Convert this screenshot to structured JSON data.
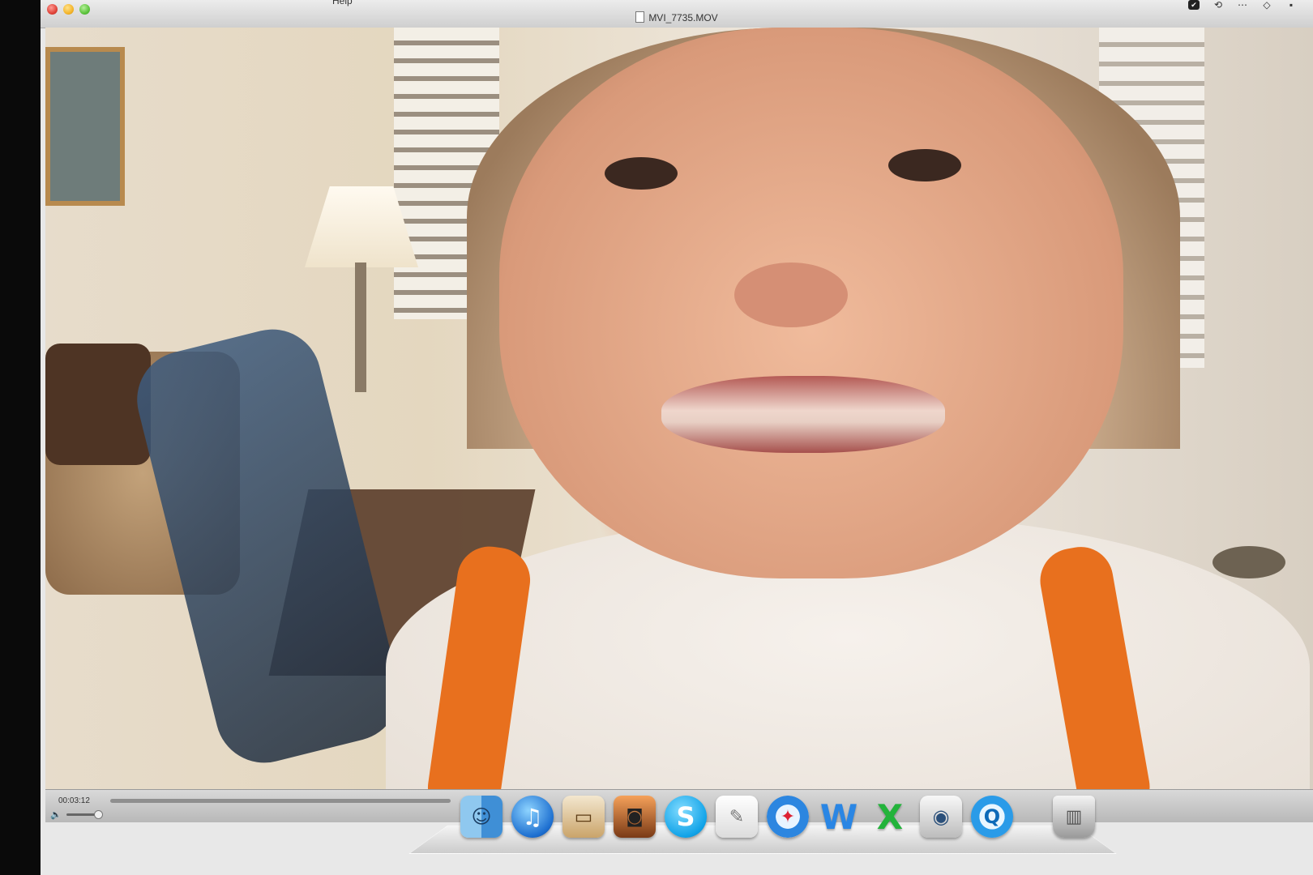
{
  "window": {
    "title": "MVI_7735.MOV",
    "menu_fragment": "Help"
  },
  "menubar_extras": [
    {
      "icon": "shield-check-icon",
      "glyph": "✔"
    },
    {
      "icon": "time-machine-icon",
      "glyph": "⟲"
    },
    {
      "icon": "sync-icon",
      "glyph": "⋯"
    },
    {
      "icon": "wifi-icon",
      "glyph": "◇"
    },
    {
      "icon": "flag-icon",
      "glyph": "▪"
    }
  ],
  "controller": {
    "timecode": "00:03:12",
    "volume_glyph": "🔈"
  },
  "dock": {
    "items": [
      {
        "name": "Finder",
        "glyph": "☺"
      },
      {
        "name": "iTunes",
        "glyph": "♫"
      },
      {
        "name": "Keynote",
        "glyph": "▭"
      },
      {
        "name": "iPhoto",
        "glyph": "◙"
      },
      {
        "name": "Skype",
        "glyph": "S"
      },
      {
        "name": "TextEdit",
        "glyph": "✎"
      },
      {
        "name": "Safari",
        "glyph": "✦"
      },
      {
        "name": "Microsoft Word",
        "glyph": "W"
      },
      {
        "name": "Microsoft Excel",
        "glyph": "X"
      },
      {
        "name": "Preview",
        "glyph": "◉"
      },
      {
        "name": "QuickTime Player",
        "glyph": "Q"
      },
      {
        "name": "Trash",
        "glyph": "▥"
      }
    ]
  },
  "colors": {
    "close": "#e0443a",
    "minimize": "#f4b52b",
    "zoom": "#5dc43d"
  }
}
